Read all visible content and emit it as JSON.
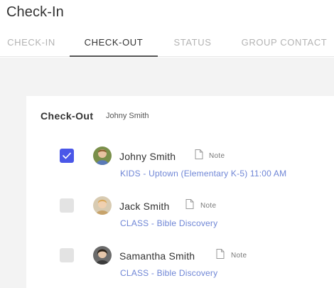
{
  "app": {
    "title": "Check-In"
  },
  "tabs": [
    {
      "label": "CHECK-IN",
      "active": false
    },
    {
      "label": "CHECK-OUT",
      "active": true
    },
    {
      "label": "STATUS",
      "active": false
    },
    {
      "label": "GROUP CONTACT",
      "active": false
    }
  ],
  "checkout": {
    "title": "Check-Out",
    "subtitle": "Johny Smith",
    "people": [
      {
        "name": "Johny Smith",
        "note_label": "Note",
        "group": "KIDS - Uptown (Elementary K-5) 11:00 AM",
        "checked": true
      },
      {
        "name": "Jack Smith",
        "note_label": "Note",
        "group": "CLASS - Bible Discovery",
        "checked": false
      },
      {
        "name": "Samantha Smith",
        "note_label": "Note",
        "group": "CLASS - Bible Discovery",
        "checked": false
      }
    ]
  },
  "colors": {
    "accent": "#4a57e8",
    "link": "#6f86d6",
    "background": "#f3f3f3"
  },
  "icons": {
    "check": "check-icon",
    "note": "note-icon"
  }
}
